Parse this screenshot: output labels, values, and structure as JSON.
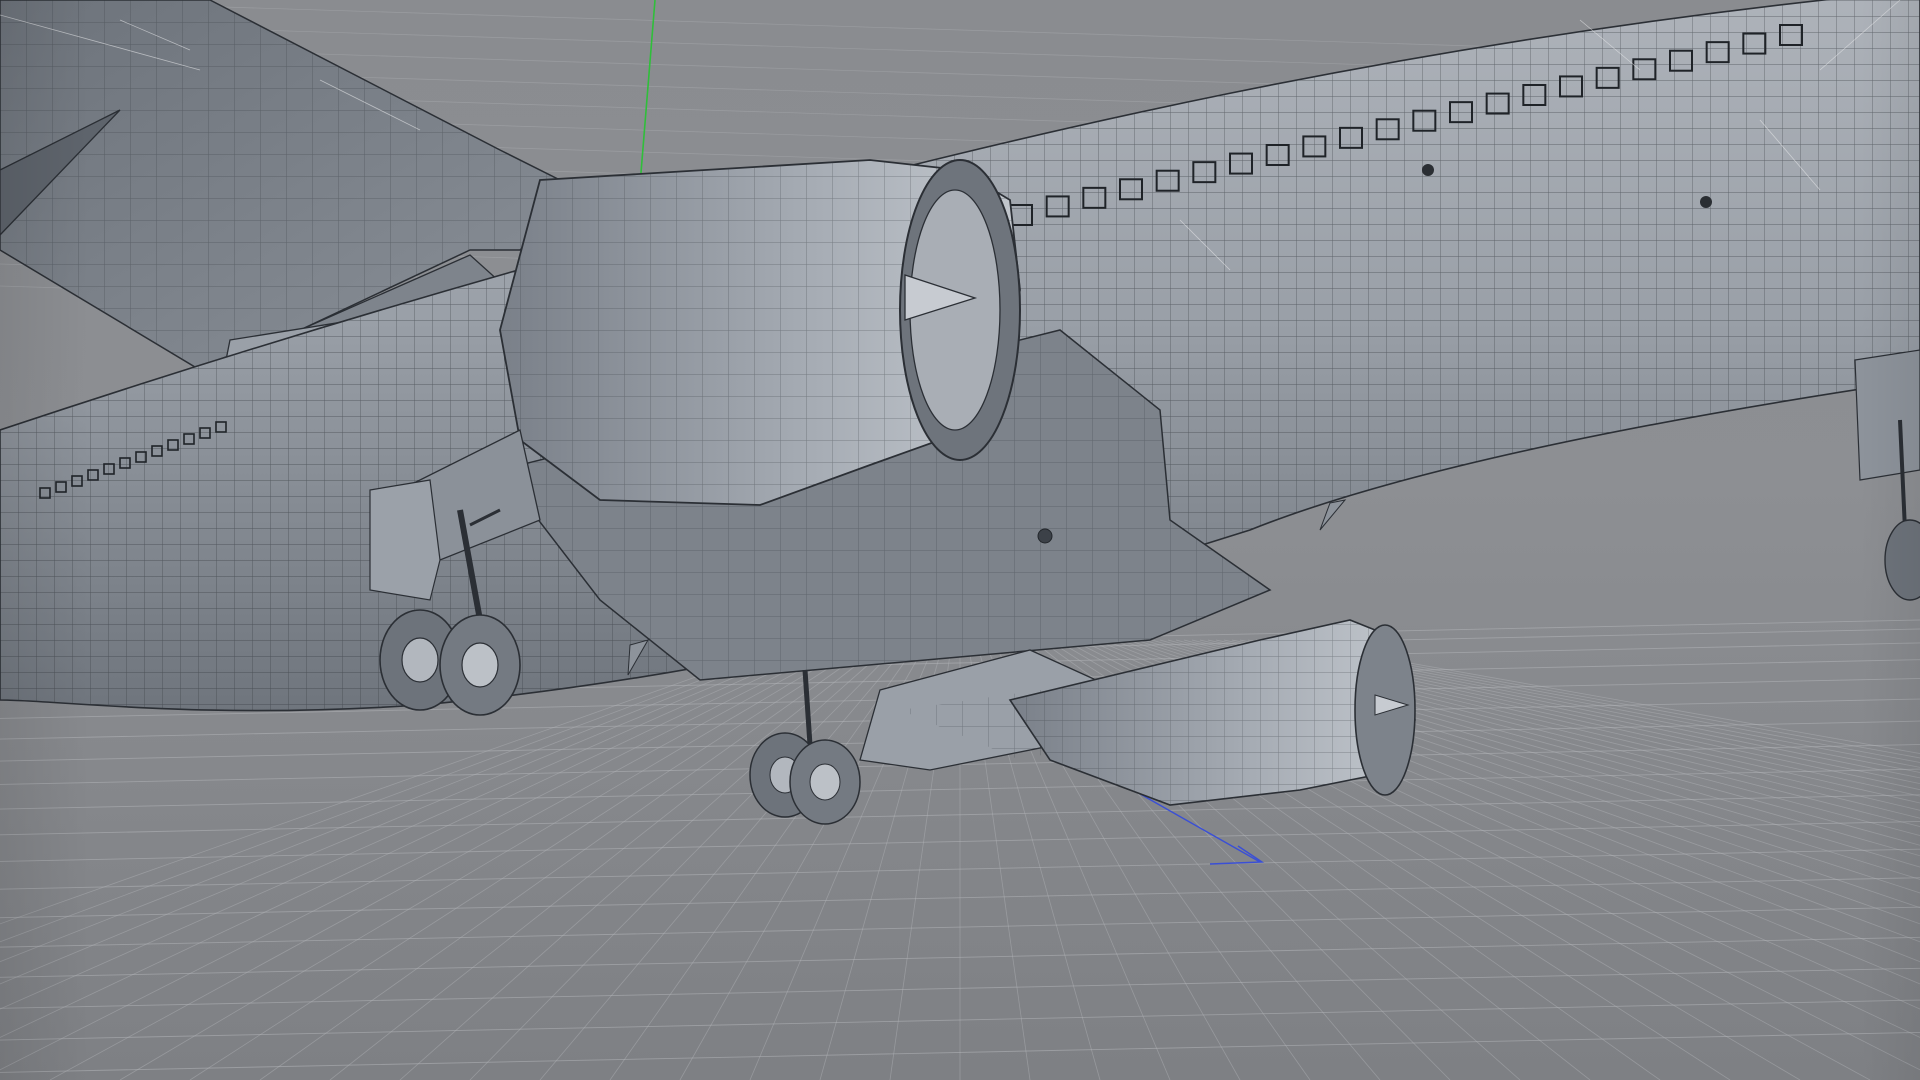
{
  "viewport": {
    "background_color": "#8d8f93",
    "grid_color": "#b4b6ba",
    "model_base_color": "#8e939b",
    "model_dark_color": "#5a5f66",
    "model_light_color": "#b7bcc3",
    "wire_color": "#2b2f35",
    "axis_colors": {
      "y": "#2fbf3a",
      "z": "#3a4fd6"
    },
    "model": "airliner-wireframe-underside",
    "view": "perspective-from-below"
  }
}
